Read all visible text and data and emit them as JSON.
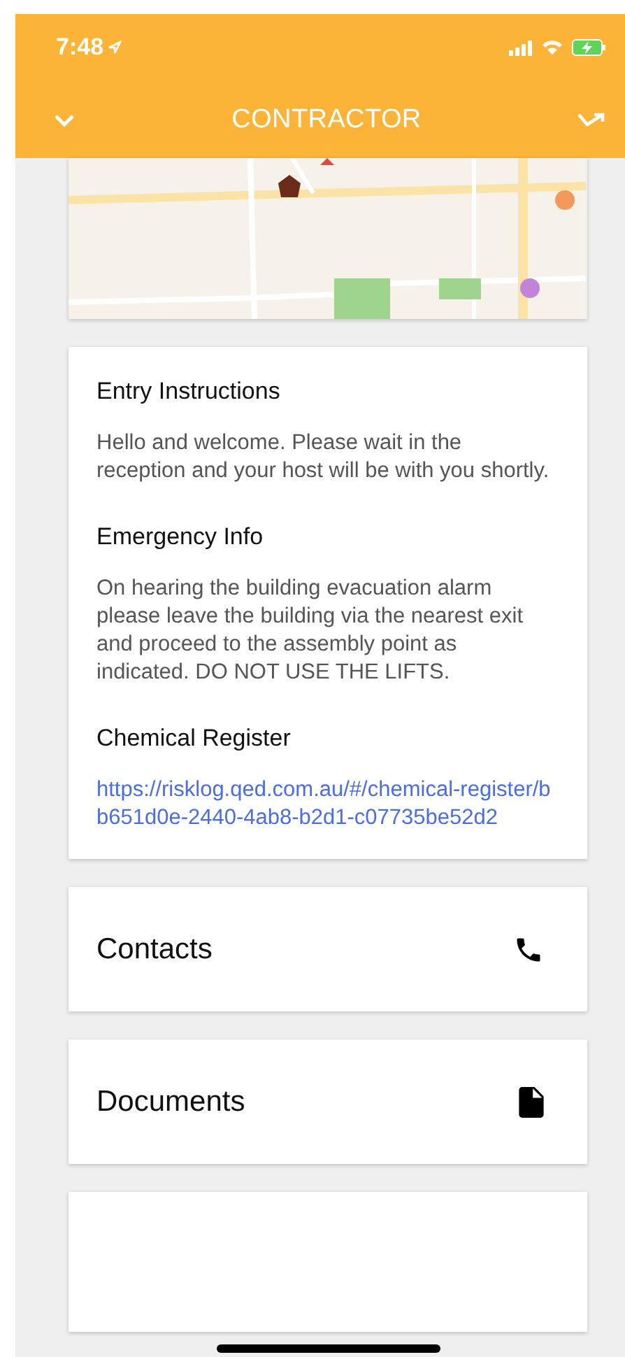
{
  "status_bar": {
    "time": "7:48"
  },
  "header": {
    "title": "CONTRACTOR"
  },
  "info_sections": [
    {
      "kind": "text",
      "heading": "Entry Instructions",
      "body": "Hello and welcome. Please wait in the reception and your host will be with you shortly."
    },
    {
      "kind": "text",
      "heading": "Emergency Info",
      "body": "On hearing the building evacuation alarm please leave the building via the nearest exit and proceed to the assembly point as indicated. DO NOT USE THE LIFTS."
    },
    {
      "kind": "link",
      "heading": "Chemical Register",
      "body": "https://risklog.qed.com.au/#/chemical-register/bb651d0e-2440-4ab8-b2d1-c07735be52d2"
    }
  ],
  "links": [
    {
      "kind": "phone",
      "label": "Contacts"
    },
    {
      "kind": "document",
      "label": "Documents"
    }
  ]
}
